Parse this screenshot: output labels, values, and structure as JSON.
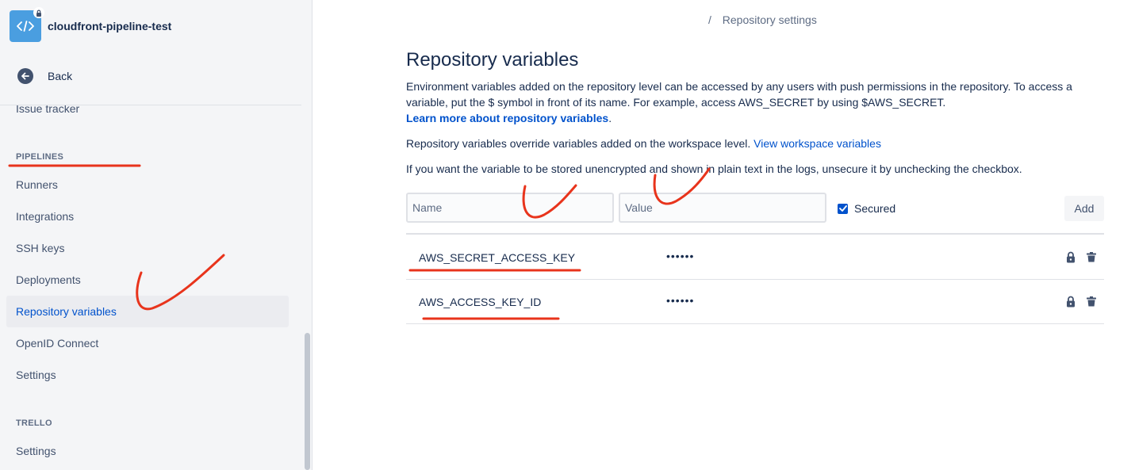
{
  "sidebar": {
    "repo_name": "cloudfront-pipeline-test",
    "back_label": "Back",
    "items": [
      {
        "label": "Issue tracker"
      },
      {
        "label": "Runners"
      },
      {
        "label": "Integrations"
      },
      {
        "label": "SSH keys"
      },
      {
        "label": "Deployments"
      },
      {
        "label": "Repository variables"
      },
      {
        "label": "OpenID Connect"
      },
      {
        "label": "Settings"
      },
      {
        "label": "Settings"
      }
    ],
    "sections": {
      "pipelines": "PIPELINES",
      "trello": "TRELLO"
    }
  },
  "breadcrumb": {
    "separator": "/",
    "current": "Repository settings"
  },
  "main": {
    "title": "Repository variables",
    "description_1": "Environment variables added on the repository level can be accessed by any users with push permissions in the repository. To access a variable, put the $ symbol in front of its name. For example, access AWS_SECRET by using $AWS_SECRET.",
    "learn_more_link": "Learn more about repository variables",
    "period": ".",
    "override_text": "Repository variables override variables added on the workspace level.",
    "workspace_link": "View workspace variables",
    "unsecure_text": "If you want the variable to be stored unencrypted and shown in plain text in the logs, unsecure it by unchecking the checkbox."
  },
  "form": {
    "name_placeholder": "Name",
    "value_placeholder": "Value",
    "secured_label": "Secured",
    "secured_checked": true,
    "add_label": "Add"
  },
  "variables": [
    {
      "name": "AWS_SECRET_ACCESS_KEY",
      "value": "••••••"
    },
    {
      "name": "AWS_ACCESS_KEY_ID",
      "value": "••••••"
    }
  ],
  "colors": {
    "accent": "#0052cc",
    "annotation": "#e8341c",
    "sidebar_bg": "#f4f5f7"
  }
}
